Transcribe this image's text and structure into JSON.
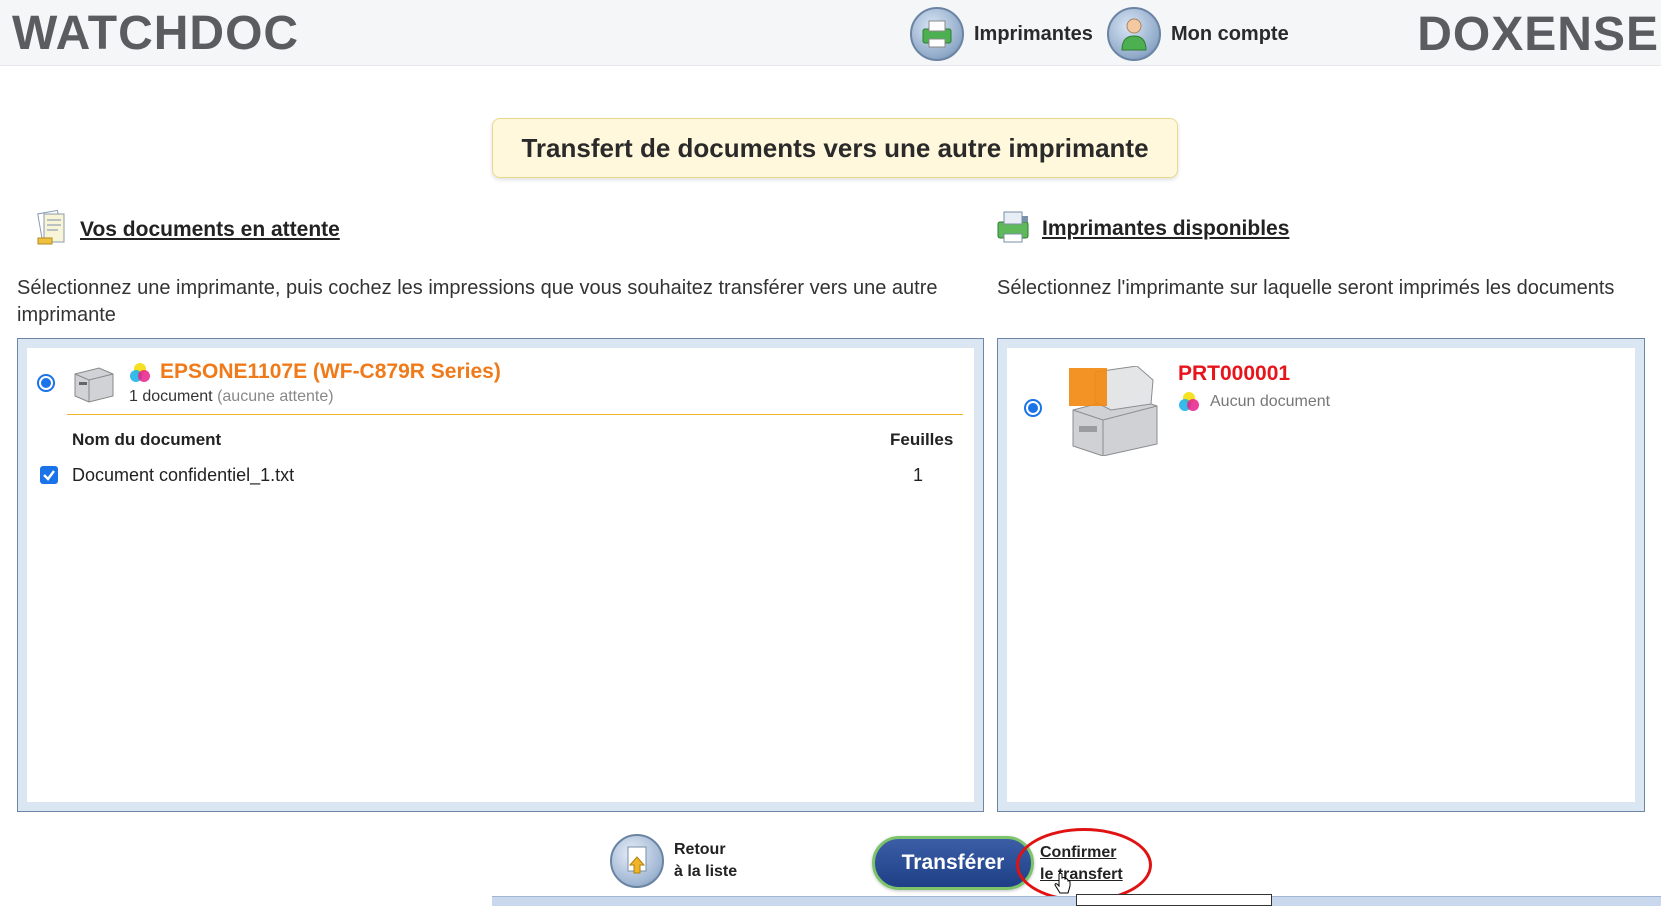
{
  "header": {
    "logo_left": "WATCHDOC",
    "logo_right": "DOXENSE",
    "nav": [
      {
        "label": "Imprimantes"
      },
      {
        "label": "Mon compte"
      }
    ]
  },
  "title": "Transfert de documents vers une autre imprimante",
  "left": {
    "heading": "Vos documents en attente",
    "description": "Sélectionnez une imprimante, puis cochez les impressions que vous souhaitez transférer vers une autre imprimante",
    "printer": {
      "name": "EPSONE1107E (WF-C879R Series)",
      "count": "1 document",
      "status": "(aucune attente)"
    },
    "table": {
      "columns": [
        "Nom du document",
        "Feuilles"
      ],
      "rows": [
        {
          "name": "Document confidentiel_1.txt",
          "sheets": "1",
          "checked": true
        }
      ]
    }
  },
  "right": {
    "heading": "Imprimantes disponibles",
    "description": "Sélectionnez l'imprimante sur laquelle seront imprimés les documents",
    "printer": {
      "name": "PRT000001",
      "status": "Aucun document"
    }
  },
  "actions": {
    "back_line1": "Retour",
    "back_line2": "à la liste",
    "transfer": "Transférer",
    "confirm_line1": "Confirmer",
    "confirm_line2": "le transfert"
  },
  "colors": {
    "accent": "#1a73e8",
    "printer_left": "#f07a1a",
    "printer_right": "#e8141b",
    "transfer_button": "#2b4c95",
    "highlight": "#e01212"
  },
  "icons": [
    "printer-nav-icon",
    "account-nav-icon",
    "documents-icon",
    "printer-available-icon",
    "color-printer-icon",
    "back-icon",
    "cursor-hand-icon"
  ]
}
